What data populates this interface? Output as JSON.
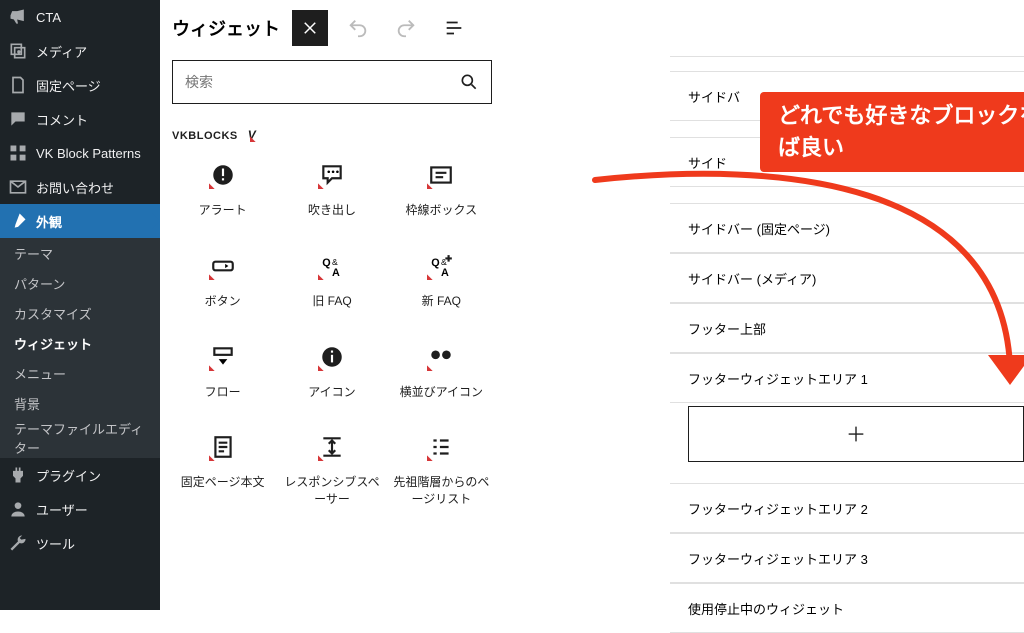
{
  "admin_menu": {
    "items": [
      {
        "label": "CTA",
        "icon": "cta"
      },
      {
        "label": "メディア",
        "icon": "media"
      },
      {
        "label": "固定ページ",
        "icon": "page"
      },
      {
        "label": "コメント",
        "icon": "comment"
      },
      {
        "label": "VK Block Patterns",
        "icon": "grid"
      },
      {
        "label": "お問い合わせ",
        "icon": "mail"
      }
    ],
    "current": {
      "label": "外観",
      "icon": "brush"
    },
    "sub": [
      {
        "label": "テーマ"
      },
      {
        "label": "パターン"
      },
      {
        "label": "カスタマイズ"
      },
      {
        "label": "ウィジェット",
        "current": true
      },
      {
        "label": "メニュー"
      },
      {
        "label": "背景"
      },
      {
        "label": "テーマファイルエディター"
      }
    ],
    "tail": [
      {
        "label": "プラグイン",
        "icon": "plugin"
      },
      {
        "label": "ユーザー",
        "icon": "user"
      },
      {
        "label": "ツール",
        "icon": "tool"
      }
    ]
  },
  "page_title": "ウィジェット",
  "search": {
    "placeholder": "検索"
  },
  "section_title": "VKBLOCKS",
  "blocks": [
    {
      "label": "アラート"
    },
    {
      "label": "吹き出し"
    },
    {
      "label": "枠線ボックス"
    },
    {
      "label": "ボタン"
    },
    {
      "label": "旧 FAQ"
    },
    {
      "label": "新 FAQ"
    },
    {
      "label": "フロー"
    },
    {
      "label": "アイコン"
    },
    {
      "label": "横並びアイコン"
    },
    {
      "label": "固定ページ本文"
    },
    {
      "label": "レスポンシブスペーサー"
    },
    {
      "label": "先祖階層からのページリスト"
    }
  ],
  "widget_areas": [
    {
      "label": "サイドバ",
      "partial": true
    },
    {
      "label": "サイド",
      "partial": true
    },
    {
      "label": "サイドバー (固定ページ)"
    },
    {
      "label": "サイドバー (メディア)"
    },
    {
      "label": "フッター上部"
    },
    {
      "label": "フッターウィジェットエリア 1",
      "expanded": true
    },
    {
      "label": "フッターウィジェットエリア 2"
    },
    {
      "label": "フッターウィジェットエリア 3"
    },
    {
      "label": "使用停止中のウィジェット"
    }
  ],
  "annotation": "どれでも好きなブロックを入れれば良い"
}
